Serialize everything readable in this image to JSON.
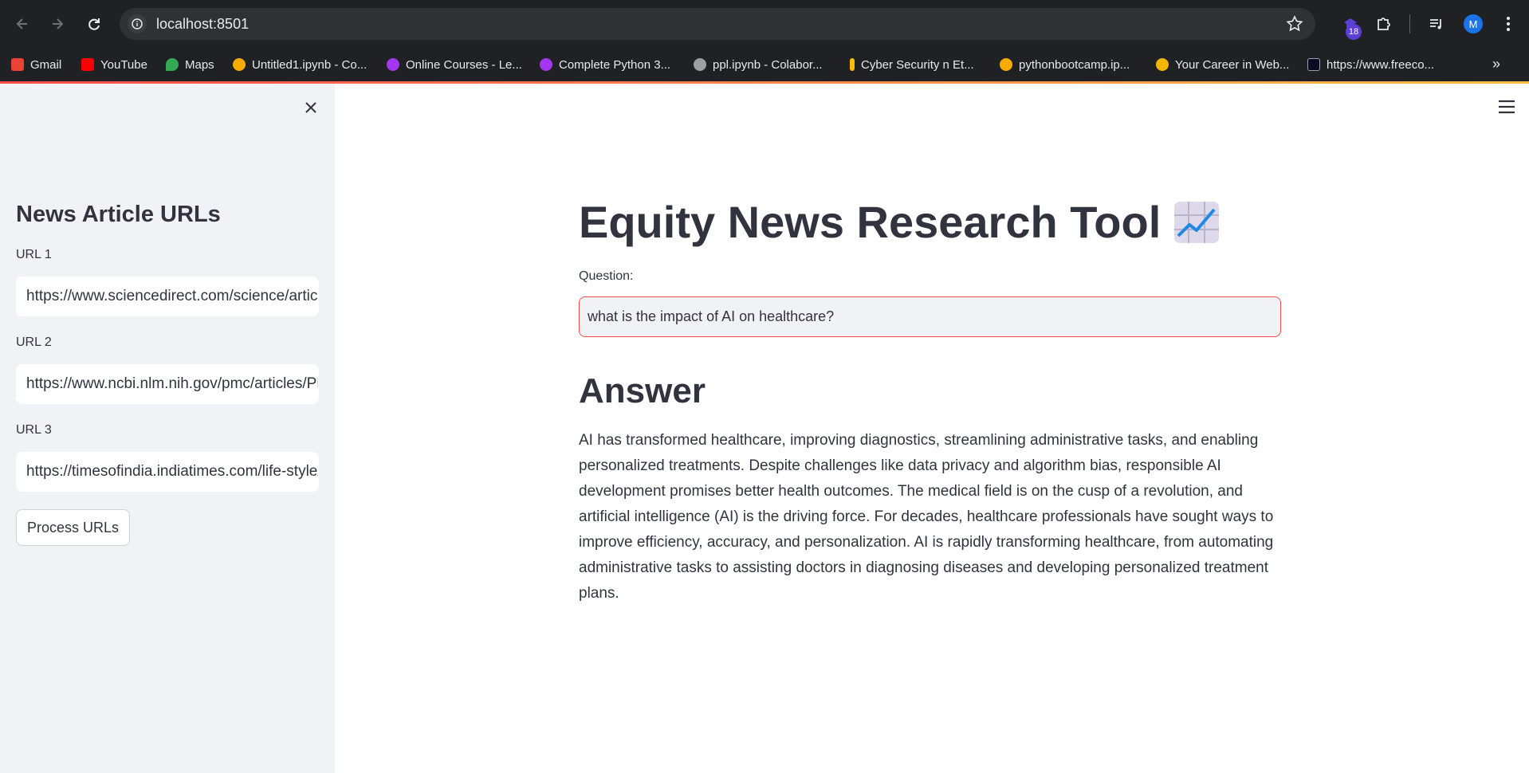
{
  "browser": {
    "url": "localhost:8501",
    "extension_badge": "18",
    "profile_initial": "M"
  },
  "bookmarks": [
    {
      "label": "Gmail",
      "icon": "gmail-icon",
      "color": "#ea4335"
    },
    {
      "label": "YouTube",
      "icon": "youtube-icon",
      "color": "#ff0000"
    },
    {
      "label": "Maps",
      "icon": "maps-icon",
      "color": "#34a853"
    },
    {
      "label": "Untitled1.ipynb - Co...",
      "icon": "colab-icon",
      "color": "#f9ab00"
    },
    {
      "label": "Online Courses - Le...",
      "icon": "udemy-icon",
      "color": "#a435f0"
    },
    {
      "label": "Complete Python 3...",
      "icon": "udemy-icon",
      "color": "#a435f0"
    },
    {
      "label": "ppl.ipynb - Colabor...",
      "icon": "colab-icon",
      "color": "#9aa0a6"
    },
    {
      "label": "Cyber Security n Et...",
      "icon": "bookmark-icon",
      "color": "#fbbc04"
    },
    {
      "label": "pythonbootcamp.ip...",
      "icon": "colab-icon",
      "color": "#f9ab00"
    },
    {
      "label": "Your Career in Web...",
      "icon": "bookmark-icon",
      "color": "#f4b400"
    },
    {
      "label": "https://www.freeco...",
      "icon": "freecodecamp-icon",
      "color": "#0a0a23"
    }
  ],
  "sidebar": {
    "title": "News Article URLs",
    "inputs": [
      {
        "label": "URL 1",
        "value": "https://www.sciencedirect.com/science/article/pii/"
      },
      {
        "label": "URL 2",
        "value": "https://www.ncbi.nlm.nih.gov/pmc/articles/PMC"
      },
      {
        "label": "URL 3",
        "value": "https://timesofindia.indiatimes.com/life-style/"
      }
    ],
    "process_button": "Process URLs"
  },
  "main": {
    "title": "Equity News Research Tool",
    "title_emoji": "chart-increasing-icon",
    "question_label": "Question:",
    "question_value": "what is the impact of AI on healthcare?",
    "answer_heading": "Answer",
    "answer_text": "AI has transformed healthcare, improving diagnostics, streamlining administrative tasks, and enabling personalized treatments. Despite challenges like data privacy and algorithm bias, responsible AI development promises better health outcomes. The medical field is on the cusp of a revolution, and artificial intelligence (AI) is the driving force. For decades, healthcare professionals have sought ways to improve efficiency, accuracy, and personalization. AI is rapidly transforming healthcare, from automating administrative tasks to assisting doctors in diagnosing diseases and developing personalized treatment plans."
  },
  "colors": {
    "accent": "#ff4b4b",
    "sidebar_bg": "#f0f2f6",
    "text": "#31333f"
  }
}
